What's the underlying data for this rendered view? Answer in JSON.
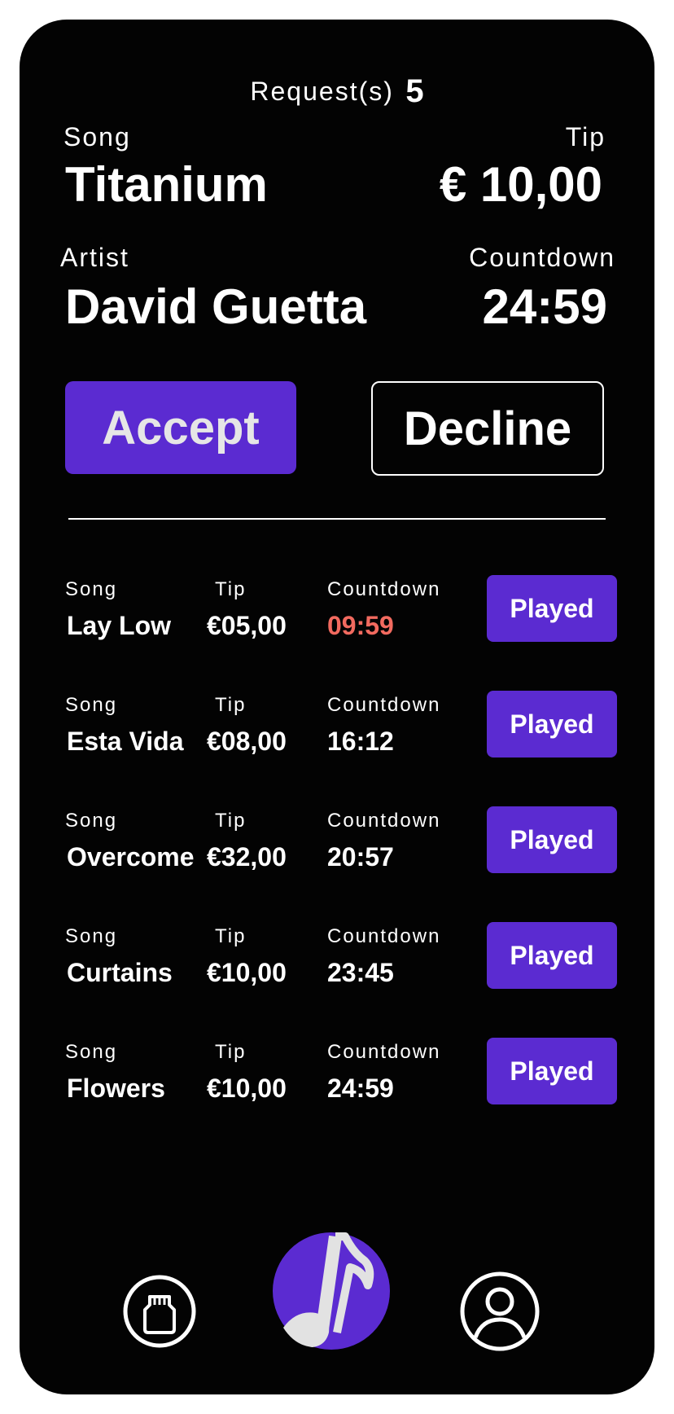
{
  "header": {
    "requests_label": "Request(s)",
    "requests_count": "5"
  },
  "current": {
    "song_label": "Song",
    "song": "Titanium",
    "tip_label": "Tip",
    "tip": "€ 10,00",
    "artist_label": "Artist",
    "artist": "David Guetta",
    "countdown_label": "Countdown",
    "countdown": "24:59"
  },
  "actions": {
    "accept": "Accept",
    "decline": "Decline"
  },
  "queue": [
    {
      "song_label": "Song",
      "tip_label": "Tip",
      "countdown_label": "Countdown",
      "song": "Lay Low",
      "tip": "€05,00",
      "countdown": "09:59",
      "countdown_color": "#f26a5f",
      "button": "Played"
    },
    {
      "song_label": "Song",
      "tip_label": "Tip",
      "countdown_label": "Countdown",
      "song": "Esta Vida",
      "tip": "€08,00",
      "countdown": "16:12",
      "countdown_color": "#ffffff",
      "button": "Played"
    },
    {
      "song_label": "Song",
      "tip_label": "Tip",
      "countdown_label": "Countdown",
      "song": "Overcome",
      "tip": "€32,00",
      "countdown": "20:57",
      "countdown_color": "#ffffff",
      "button": "Played"
    },
    {
      "song_label": "Song",
      "tip_label": "Tip",
      "countdown_label": "Countdown",
      "song": "Curtains",
      "tip": "€10,00",
      "countdown": "23:45",
      "countdown_color": "#ffffff",
      "button": "Played"
    },
    {
      "song_label": "Song",
      "tip_label": "Tip",
      "countdown_label": "Countdown",
      "song": "Flowers",
      "tip": "€10,00",
      "countdown": "24:59",
      "countdown_color": "#ffffff",
      "button": "Played"
    }
  ],
  "bottom_nav": {
    "left_icon": "sd-card-icon",
    "center_icon": "music-note-icon",
    "right_icon": "user-profile-icon"
  },
  "colors": {
    "accent": "#5b2bd1",
    "background": "#030303",
    "warning": "#f26a5f"
  }
}
